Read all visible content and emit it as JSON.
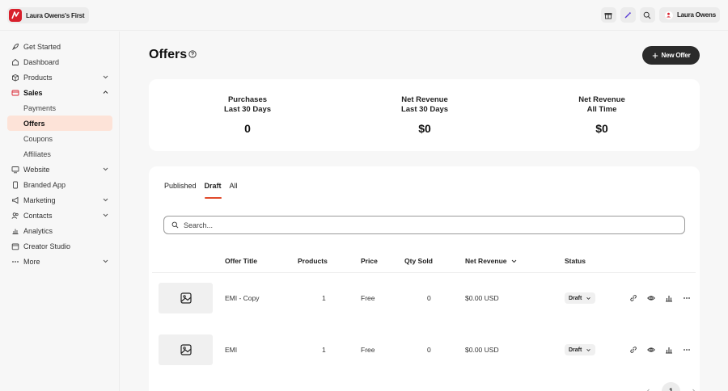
{
  "app": {
    "workspace_name": "Laura Owens's First",
    "user_name": "Laura Owens"
  },
  "colors": {
    "brand": "#d8202c",
    "accent": "#e04a2b",
    "active_nav_bg": "#fde3d8",
    "primary_button": "#2b2b2b"
  },
  "sidebar": {
    "items": [
      {
        "label": "Get Started",
        "icon": "rocket-icon"
      },
      {
        "label": "Dashboard",
        "icon": "home-icon"
      },
      {
        "label": "Products",
        "icon": "box-icon",
        "expandable": true
      },
      {
        "label": "Sales",
        "icon": "credit-card-icon",
        "expanded": true,
        "children": [
          "Payments",
          "Offers",
          "Coupons",
          "Affiliates"
        ],
        "active_child": "Offers"
      },
      {
        "label": "Website",
        "icon": "monitor-icon",
        "expandable": true
      },
      {
        "label": "Branded App",
        "icon": "phone-icon"
      },
      {
        "label": "Marketing",
        "icon": "megaphone-icon",
        "expandable": true
      },
      {
        "label": "Contacts",
        "icon": "people-icon",
        "expandable": true
      },
      {
        "label": "Analytics",
        "icon": "bar-chart-icon"
      },
      {
        "label": "Creator Studio",
        "icon": "calendar-icon"
      },
      {
        "label": "More",
        "icon": "dots-icon",
        "expandable": true
      }
    ]
  },
  "header": {
    "title": "Offers",
    "new_offer_label": "New Offer"
  },
  "stats": [
    {
      "label_line1": "Purchases",
      "label_line2": "Last 30 Days",
      "value": "0"
    },
    {
      "label_line1": "Net Revenue",
      "label_line2": "Last 30 Days",
      "value": "$0"
    },
    {
      "label_line1": "Net Revenue",
      "label_line2": "All Time",
      "value": "$0"
    }
  ],
  "tabs": [
    {
      "label": "Published",
      "active": false
    },
    {
      "label": "Draft",
      "active": true
    },
    {
      "label": "All",
      "active": false
    }
  ],
  "search": {
    "placeholder": "Search..."
  },
  "table": {
    "columns": [
      "Offer Title",
      "Products",
      "Price",
      "Qty Sold",
      "Net Revenue",
      "Status"
    ],
    "sort_column": "Net Revenue",
    "rows": [
      {
        "title": "EMI - Copy",
        "products": "1",
        "price": "Free",
        "qty_sold": "0",
        "net_revenue": "$0.00 USD",
        "status": "Draft"
      },
      {
        "title": "EMI",
        "products": "1",
        "price": "Free",
        "qty_sold": "0",
        "net_revenue": "$0.00 USD",
        "status": "Draft"
      }
    ]
  },
  "pagination": {
    "current_page": "1"
  }
}
